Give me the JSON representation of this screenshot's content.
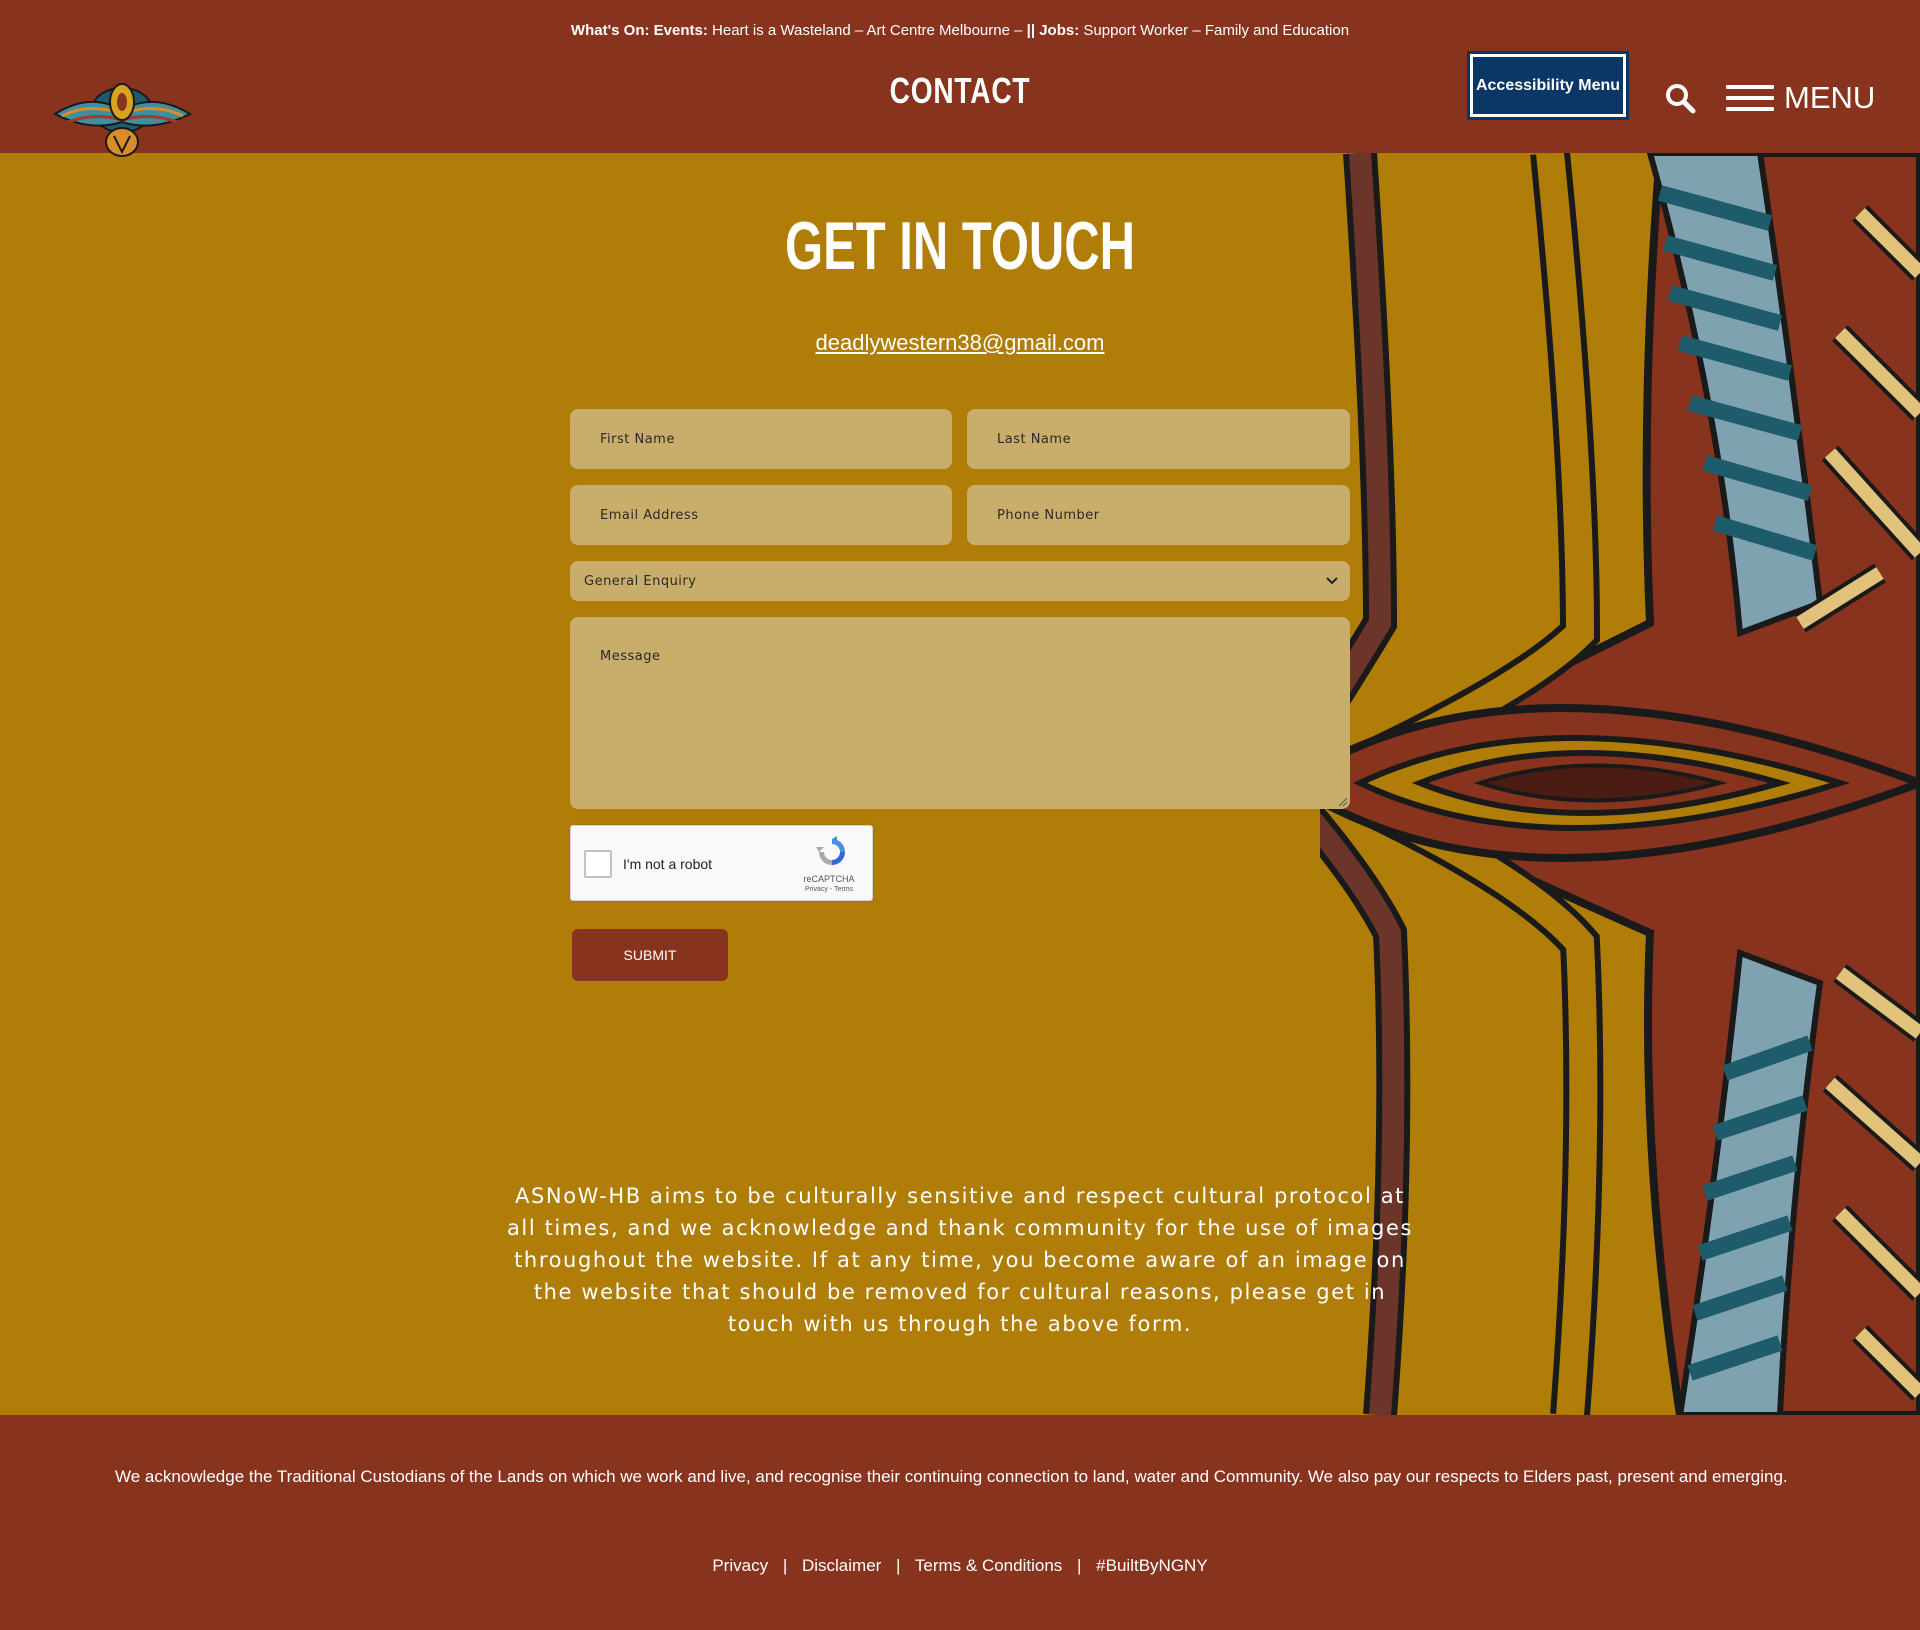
{
  "header": {
    "ticker": {
      "whats_on_label": "What's On:",
      "events_label": "Events:",
      "events_text": "Heart is a Wasteland – Art Centre Melbourne –",
      "divider": "||",
      "jobs_label": "Jobs:",
      "jobs_text": "Support Worker – Family and Education"
    },
    "page_title": "CONTACT",
    "accessibility_label": "Accessibility Menu",
    "search_icon": "search-icon",
    "menu_label": "MENU"
  },
  "main": {
    "heading": "GET IN TOUCH",
    "email": "deadlywestern38@gmail.com",
    "form": {
      "first_name_placeholder": "First Name",
      "last_name_placeholder": "Last Name",
      "email_placeholder": "Email Address",
      "phone_placeholder": "Phone Number",
      "enquiry_selected": "General Enquiry",
      "message_placeholder": "Message",
      "captcha_label": "I'm not a robot",
      "captcha_brand": "reCAPTCHA",
      "captcha_links": "Privacy - Terms",
      "submit_label": "SUBMIT"
    },
    "statement": "ASNoW-HB aims to be culturally sensitive and respect cultural protocol at all times, and we acknowledge and thank community for the use of images throughout the website. If at any time, you become aware of an image on the website that should be removed for cultural reasons, please get in touch with us through the above form."
  },
  "footer": {
    "acknowledgement": "We acknowledge the Traditional Custodians of the Lands on which we work and live, and recognise their continuing connection to land, water and Community. We also pay our respects to Elders past, present and emerging.",
    "links": {
      "privacy": "Privacy",
      "disclaimer": "Disclaimer",
      "terms": "Terms & Conditions",
      "built_by": "#BuiltByNGNY",
      "separator": "|"
    }
  },
  "colors": {
    "header_bg": "#88331d",
    "body_bg": "#b07d09",
    "field_bg": "#c9ad6b",
    "accessibility_bg": "#0b3766"
  }
}
